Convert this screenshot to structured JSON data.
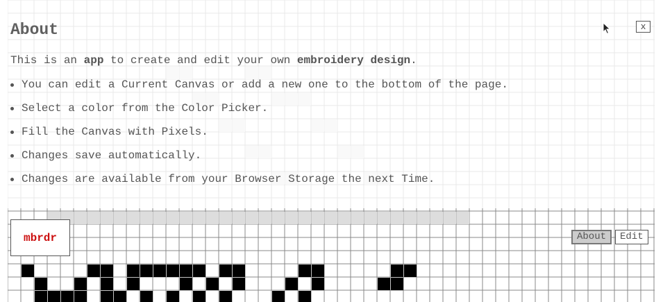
{
  "about": {
    "title": "About",
    "close_label": "x",
    "intro": {
      "prefix": "This is an ",
      "app": "app",
      "middle": " to create and edit your own ",
      "design": "embroidery design",
      "suffix": "."
    },
    "bullets": [
      "You can edit a Current Canvas or add a new one to the bottom of the page.",
      "Select a color from the Color Picker.",
      "Fill the Canvas with Pixels.",
      "Changes save automatically.",
      "Changes are available from your Browser Storage the next Time."
    ]
  },
  "logo": {
    "text": "mbrdr"
  },
  "nav": {
    "about_label": "About",
    "edit_label": "Edit",
    "active": "about"
  },
  "colors": {
    "pixel_fill": "#000000",
    "pixel_light": "#dddddd",
    "grid_line": "#888888",
    "logo_text": "#cc1111",
    "active_button": "#cccccc"
  },
  "icons": {
    "cursor": "mouse-pointer-icon"
  }
}
